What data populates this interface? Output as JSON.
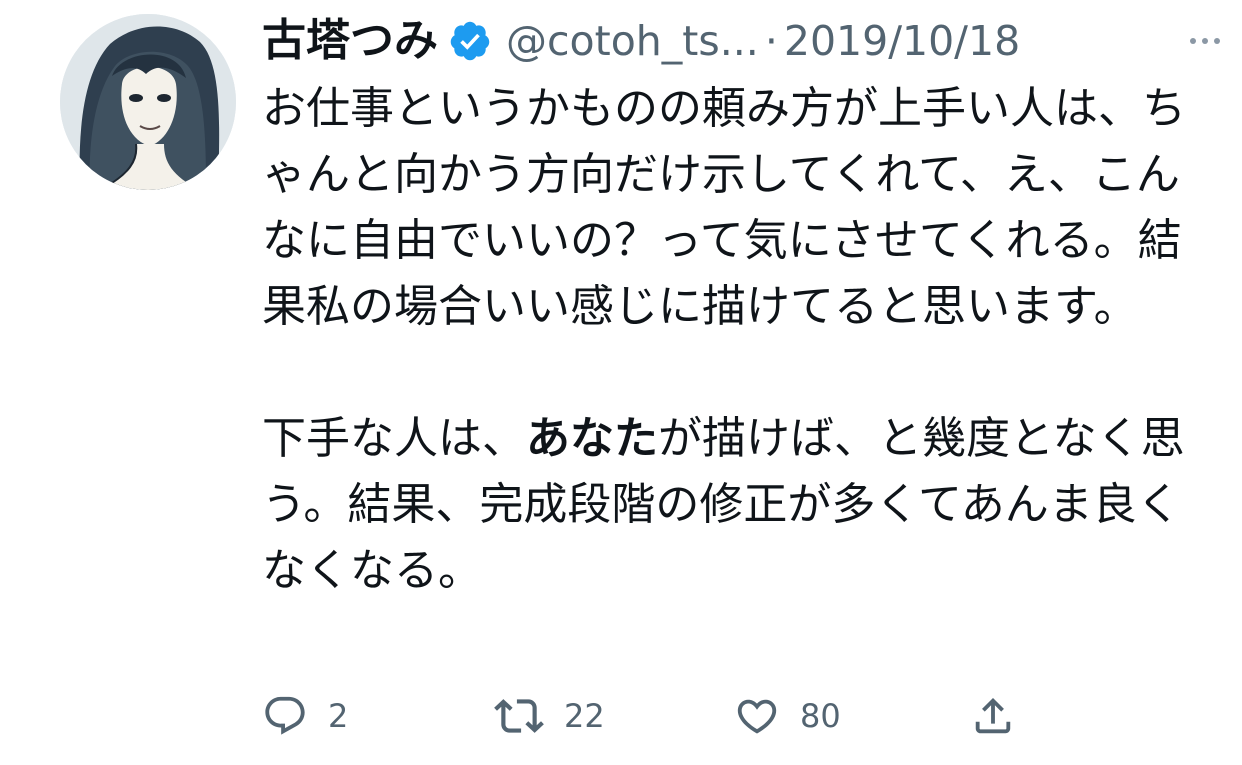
{
  "tweet": {
    "author": {
      "display_name": "古塔つみ",
      "handle": "@cotoh_ts...",
      "verified": true
    },
    "separator": "·",
    "date": "2019/10/18",
    "body": {
      "paragraph1": "お仕事というかものの頼み方が上手い人は、ちゃんと向かう方向だけ示してくれて、え、こんなに自由でいいの？って気にさせてくれる。結果私の場合いい感じに描けてると思います。",
      "paragraph2_before": "下手な人は、",
      "paragraph2_bold": "あなた",
      "paragraph2_after": "が描けば、と幾度となく思う。結果、完成段階の修正が多くてあんま良くなくなる。"
    },
    "actions": {
      "reply_count": "2",
      "retweet_count": "22",
      "like_count": "80"
    }
  },
  "icons": {
    "verified": "verified-badge-icon",
    "more": "more-options-icon",
    "reply": "reply-icon",
    "retweet": "retweet-icon",
    "like": "heart-icon",
    "share": "share-icon"
  },
  "colors": {
    "text_primary": "#0f1419",
    "text_secondary": "#536471",
    "verified_blue": "#1d9bf0",
    "icon_gray": "#536471"
  }
}
